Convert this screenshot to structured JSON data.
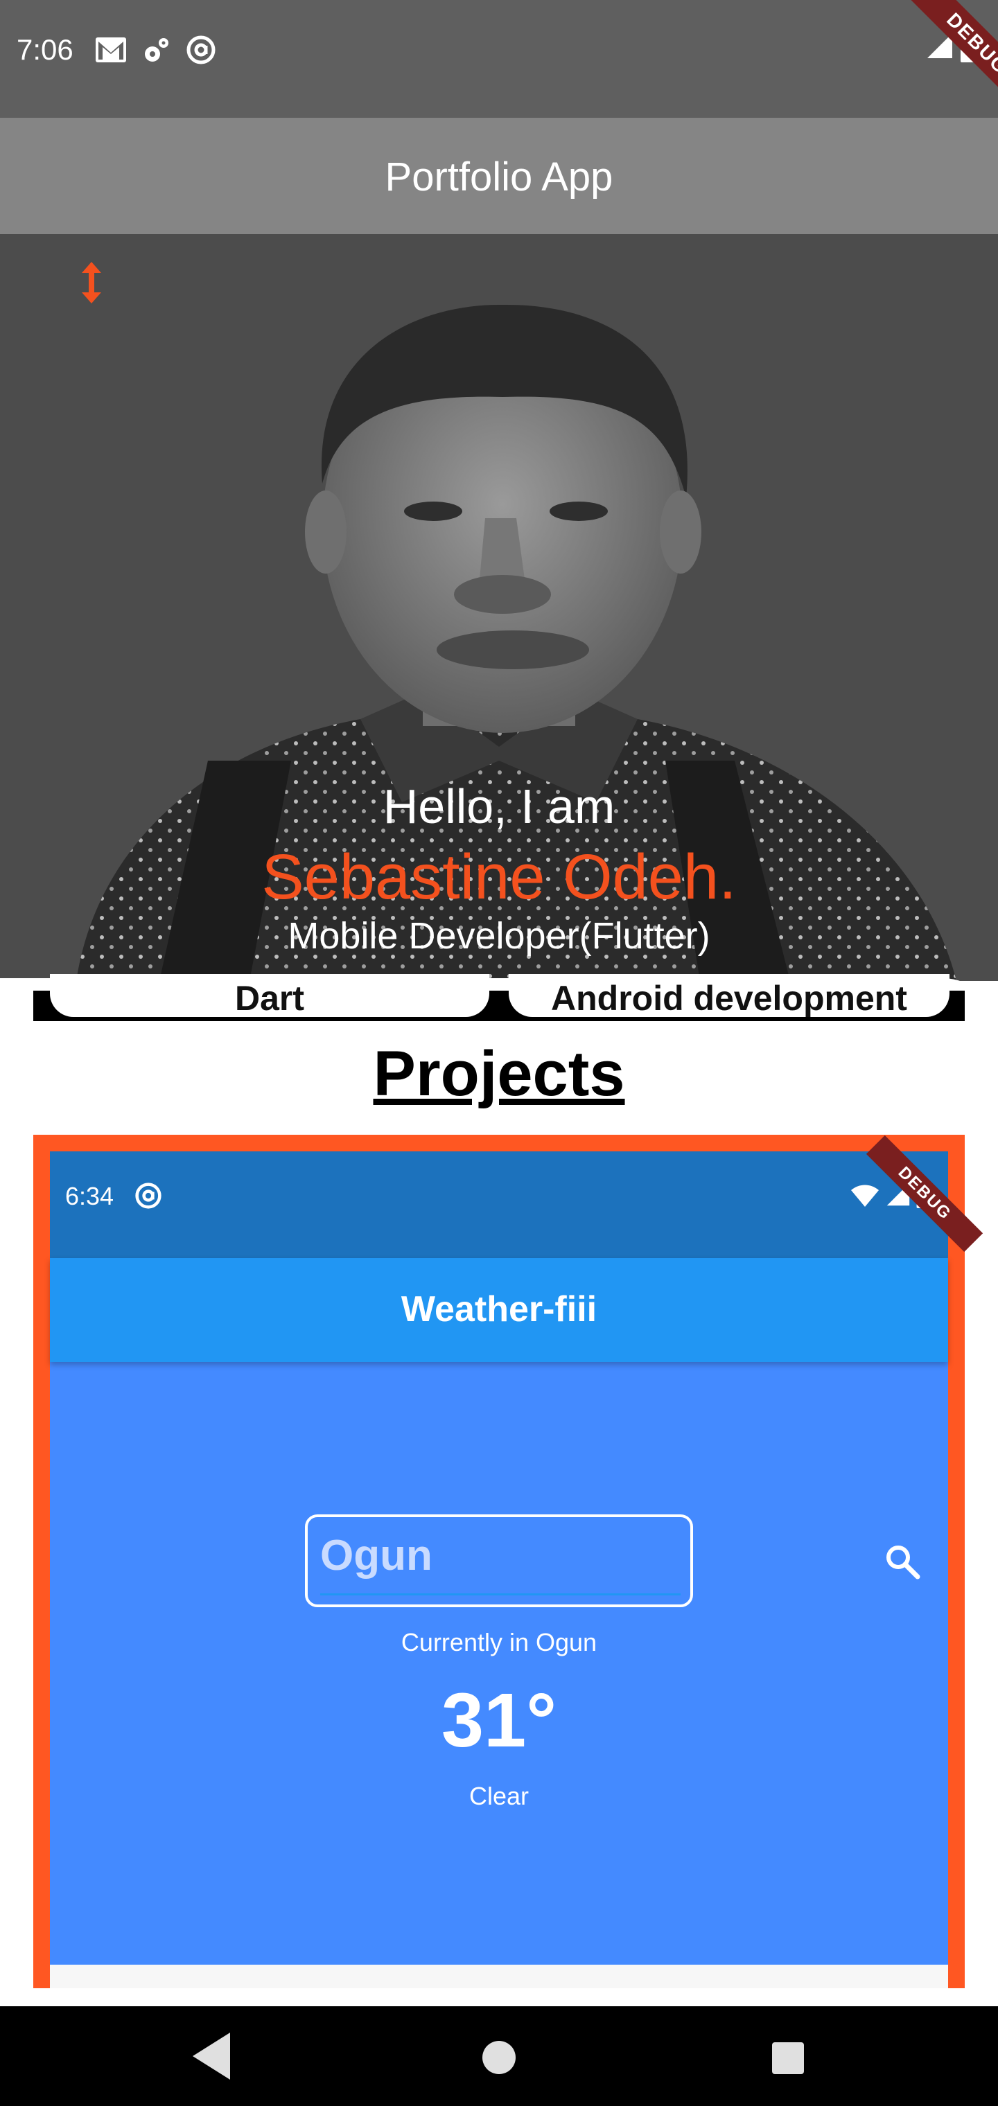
{
  "status_bar": {
    "time": "7:06",
    "icons": [
      "gmail-icon",
      "settings-icon",
      "at-sign-icon"
    ],
    "right_icons": [
      "signal-icon",
      "battery-icon"
    ],
    "debug_label": "DEBUG"
  },
  "app_bar": {
    "title": "Portfolio App"
  },
  "hero": {
    "expand_icon": "vertical-arrows-icon",
    "greeting": "Hello, I am",
    "name": "Sebastine Odeh.",
    "role": "Mobile Developer(Flutter)",
    "accent_color": "#f4511e"
  },
  "skills": [
    "Dart",
    "Android development"
  ],
  "projects": {
    "title": "Projects",
    "frame_color": "#ff5722",
    "items": [
      {
        "status_time": "6:34",
        "debug_label": "DEBUG",
        "app_title": "Weather-fiii",
        "input_value": "Ogun",
        "current_label": "Currently in Ogun",
        "temperature": "31°",
        "condition": "Clear",
        "background_color": "#448aff",
        "appbar_color": "#2196f3"
      }
    ]
  },
  "nav_bar": {
    "icons": [
      "back-icon",
      "home-icon",
      "recents-icon"
    ]
  }
}
